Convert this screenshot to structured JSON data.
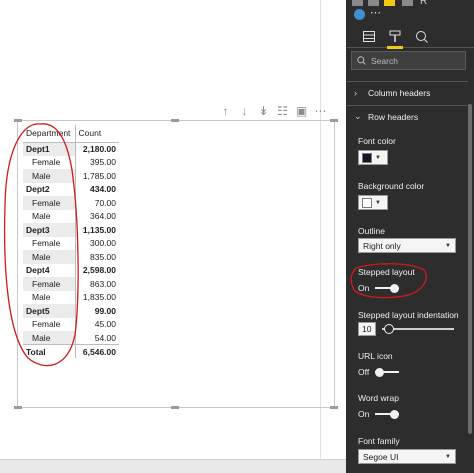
{
  "matrix": {
    "headers": {
      "department": "Department",
      "count": "Count"
    },
    "rows": [
      {
        "label": "Dept1",
        "value": "2,180.00",
        "level": "dept"
      },
      {
        "label": "Female",
        "value": "395.00",
        "level": "sub"
      },
      {
        "label": "Male",
        "value": "1,785.00",
        "level": "sub"
      },
      {
        "label": "Dept2",
        "value": "434.00",
        "level": "dept"
      },
      {
        "label": "Female",
        "value": "70.00",
        "level": "sub"
      },
      {
        "label": "Male",
        "value": "364.00",
        "level": "sub"
      },
      {
        "label": "Dept3",
        "value": "1,135.00",
        "level": "dept"
      },
      {
        "label": "Female",
        "value": "300.00",
        "level": "sub"
      },
      {
        "label": "Male",
        "value": "835.00",
        "level": "sub"
      },
      {
        "label": "Dept4",
        "value": "2,598.00",
        "level": "dept"
      },
      {
        "label": "Female",
        "value": "863.00",
        "level": "sub"
      },
      {
        "label": "Male",
        "value": "1,835.00",
        "level": "sub"
      },
      {
        "label": "Dept5",
        "value": "99.00",
        "level": "dept"
      },
      {
        "label": "Female",
        "value": "45.00",
        "level": "sub"
      },
      {
        "label": "Male",
        "value": "54.00",
        "level": "sub"
      }
    ],
    "total": {
      "label": "Total",
      "value": "6,546.00"
    }
  },
  "pane": {
    "search_placeholder": "Search",
    "sections": {
      "column_headers": "Column headers",
      "row_headers": "Row headers"
    },
    "font_color": {
      "label": "Font color",
      "swatch": "#111827"
    },
    "background_color": {
      "label": "Background color",
      "swatch": "#ffffff"
    },
    "outline": {
      "label": "Outline",
      "value": "Right only"
    },
    "stepped_layout": {
      "label": "Stepped layout",
      "state": "On"
    },
    "stepped_indentation": {
      "label": "Stepped layout indentation",
      "value": "10"
    },
    "url_icon": {
      "label": "URL icon",
      "state": "Off"
    },
    "word_wrap": {
      "label": "Word wrap",
      "state": "On"
    },
    "font_family": {
      "label": "Font family",
      "value": "Segoe UI"
    }
  },
  "colors": {
    "pane_bg": "#2d2d2d",
    "active_tab_accent": "#f2c811",
    "annotation": "#d11a1a"
  },
  "icons": {
    "toolbar": [
      "arrow-up-icon",
      "arrow-down-icon",
      "double-arrow-down-icon",
      "expand-hierarchy-icon",
      "focus-mode-icon",
      "more-options-icon"
    ],
    "tabs": [
      "fields-icon",
      "format-paint-roller-icon",
      "analytics-icon"
    ]
  }
}
